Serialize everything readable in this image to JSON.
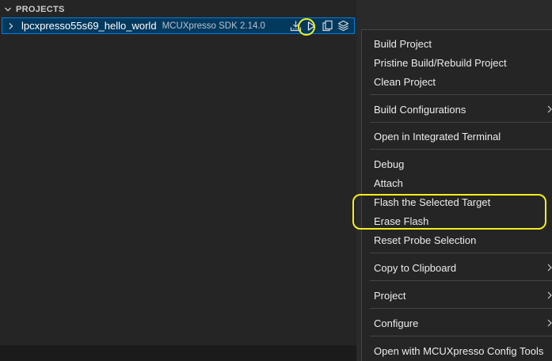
{
  "sidebar": {
    "section_title": "PROJECTS",
    "project": {
      "name": "lpcxpresso55s69_hello_world",
      "description": "MCUXpresso SDK 2.14.0"
    },
    "actions": {
      "import_icon": "download-icon",
      "run_icon": "play-icon",
      "copy_icon": "copy-icon",
      "layers_icon": "layers-icon"
    }
  },
  "context_menu": {
    "items": [
      {
        "label": "Build Project"
      },
      {
        "label": "Pristine Build/Rebuild Project"
      },
      {
        "label": "Clean Project"
      },
      {
        "label": "Build Configurations"
      },
      {
        "label": "Open in Integrated Terminal"
      },
      {
        "label": "Debug"
      },
      {
        "label": "Attach"
      },
      {
        "label": "Flash the Selected Target"
      },
      {
        "label": "Erase Flash"
      },
      {
        "label": "Reset Probe Selection"
      },
      {
        "label": "Copy to Clipboard"
      },
      {
        "label": "Project"
      },
      {
        "label": "Configure"
      },
      {
        "label": "Open with MCUXpresso Config Tools"
      }
    ]
  },
  "colors": {
    "highlight": "#f5ef1c",
    "selection": "#04395e",
    "focus_border": "#007fd4"
  }
}
